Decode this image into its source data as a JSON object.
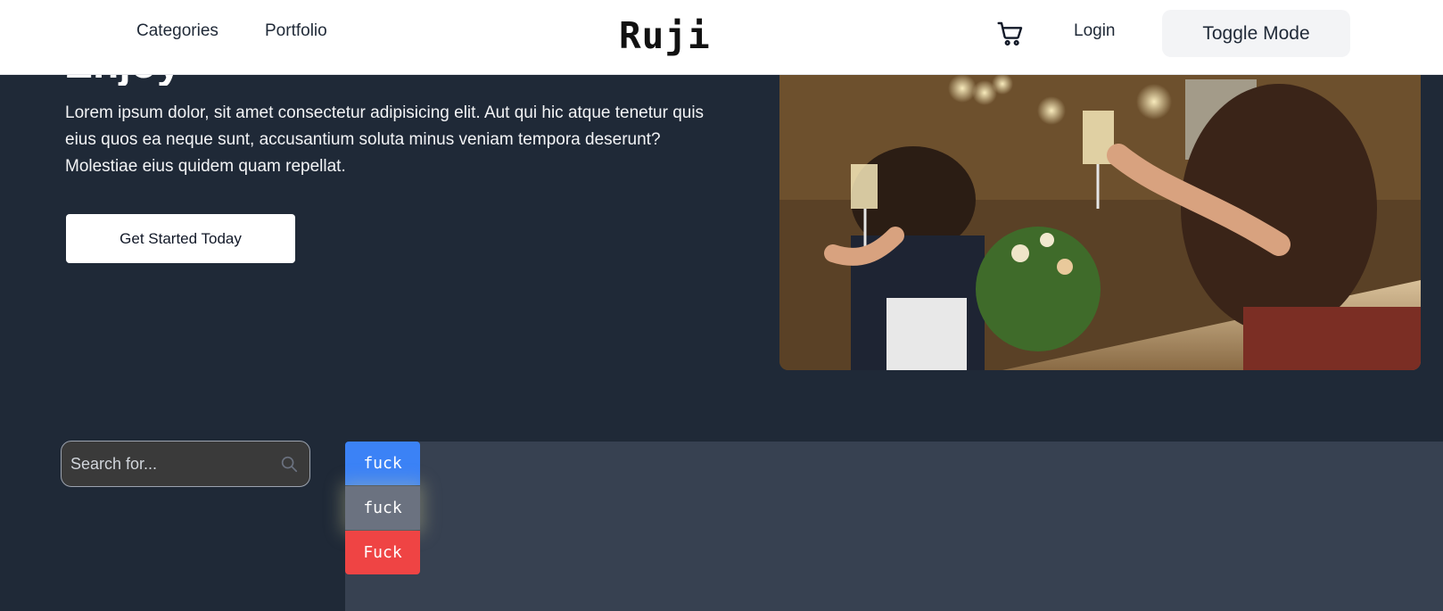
{
  "header": {
    "nav": [
      {
        "label": "Categories"
      },
      {
        "label": "Portfolio"
      }
    ],
    "brand": "Ruji",
    "cart_icon": "cart-icon",
    "login_label": "Login",
    "toggle_label": "Toggle Mode"
  },
  "hero": {
    "title": "Enjoy",
    "text": "Lorem ipsum dolor, sit amet consectetur adipisicing elit. Aut qui hic atque tenetur quis eius quos ea neque sunt, accusantium soluta minus veniam tempora deserunt? Molestiae eius quidem quam repellat.",
    "cta_label": "Get Started Today",
    "image_alt": "People toasting with champagne glasses at a dinner party"
  },
  "search": {
    "placeholder": "Search for...",
    "icon": "search-icon"
  },
  "tags": [
    {
      "label": "fuck",
      "color": "#3b82f6"
    },
    {
      "label": "fuck",
      "color": "#6b7280"
    },
    {
      "label": "Fuck",
      "color": "#ef4444"
    }
  ],
  "colors": {
    "background": "#1f2937",
    "panel": "#374151",
    "header": "#ffffff"
  }
}
